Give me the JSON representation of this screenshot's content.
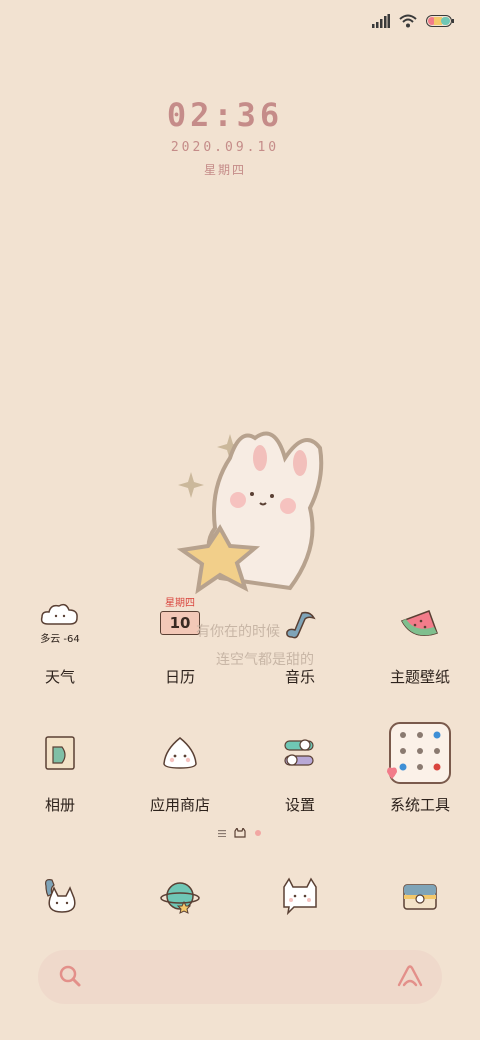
{
  "status_bar": {
    "icons": [
      "signal-icon",
      "wifi-icon",
      "battery-icon"
    ],
    "battery_colors": [
      "#f27c8a",
      "#f4c86a",
      "#6fc7b5"
    ]
  },
  "clock": {
    "time": "02:36",
    "date": "2020.09.10",
    "weekday": "星期四"
  },
  "wallpaper": {
    "caption_line1": "有你在的时候",
    "caption_line2": "连空气都是甜的"
  },
  "home_grid": {
    "row1": [
      {
        "label": "天气",
        "icon": "weather-cloud-icon",
        "widget_text": "多云 -64"
      },
      {
        "label": "日历",
        "icon": "calendar-icon",
        "widget_weekday": "星期四",
        "widget_day": "10"
      },
      {
        "label": "音乐",
        "icon": "music-note-icon"
      },
      {
        "label": "主题壁纸",
        "icon": "watermelon-icon"
      }
    ],
    "row2": [
      {
        "label": "相册",
        "icon": "album-icon"
      },
      {
        "label": "应用商店",
        "icon": "rice-ball-icon"
      },
      {
        "label": "设置",
        "icon": "settings-toggle-icon"
      },
      {
        "label": "系统工具",
        "icon": "system-tools-folder-icon"
      }
    ]
  },
  "page_indicator": [
    "menu",
    "home",
    "page"
  ],
  "dock": [
    {
      "icon": "phone-bunny-icon"
    },
    {
      "icon": "planet-browser-icon"
    },
    {
      "icon": "bunny-message-icon"
    },
    {
      "icon": "camera-icon"
    }
  ],
  "search_bar": {
    "placeholder": "",
    "left_icon": "search-icon",
    "right_icon": "assistant-icon"
  },
  "colors": {
    "background": "#f2e2d1",
    "accent_pink": "#c58c89",
    "label_text": "#2d221c",
    "search_bg": "#efd9cb"
  }
}
